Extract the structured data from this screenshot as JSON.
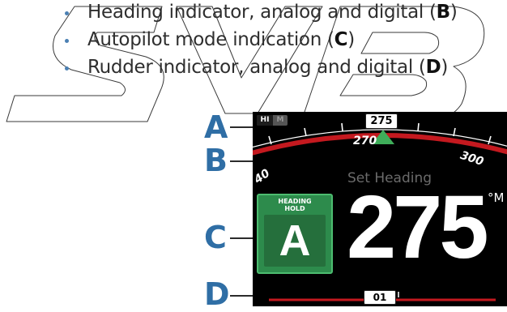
{
  "bullets": [
    {
      "text": "Heading indicator, analog and digital (",
      "letter": "B",
      "close": ")"
    },
    {
      "text": "Autopilot mode indication (",
      "letter": "C",
      "close": ")"
    },
    {
      "text": "Rudder indicator, analog and digital (",
      "letter": "D",
      "close": ")"
    }
  ],
  "callouts": {
    "a": "A",
    "b": "B",
    "c": "C",
    "d": "D"
  },
  "display": {
    "mode_toggle": {
      "hi": "HI",
      "m": "M"
    },
    "heading_readout": "275",
    "scale_labels": {
      "left": "270",
      "right": "300",
      "far_left": "40"
    },
    "set_heading_label": "Set Heading",
    "set_heading_value": "275",
    "unit": "°M",
    "mode_panel": {
      "title_line1": "HEADING",
      "title_line2": "HOLD",
      "letter": "A"
    },
    "rudder_readout": "01"
  },
  "colors": {
    "accent_blue": "#2f6ea5",
    "screen_bg": "#000000",
    "heading_arc": "#c4191f",
    "mode_green": "#2d8b4c",
    "pointer_green": "#3fae5a"
  }
}
